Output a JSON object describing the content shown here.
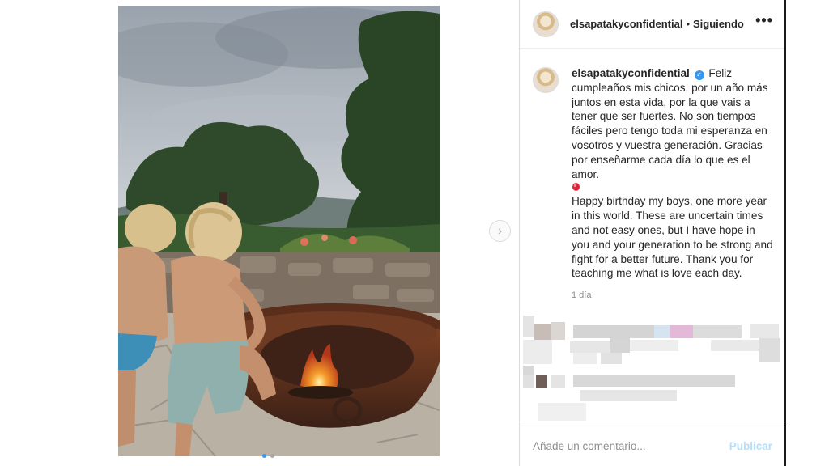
{
  "post": {
    "username": "elsapatakyconfidential",
    "separator": "•",
    "follow_status": "Siguiendo",
    "more_icon": "more-options-icon",
    "caption_spanish": "Feliz cumpleaños mis chicos, por un año más juntos en esta vida, por la que vais a tener que ser fuertes. No son tiempos fáciles pero tengo toda mi esperanza en vosotros y vuestra generación. Gracias por enseñarme cada día lo que es el amor.",
    "caption_english": "Happy birthday my boys, one more year in this world. These are uncertain times and not easy ones, but I have hope in you and your generation to be strong and fight for a better future. Thank you for teaching me what is love each day.",
    "verified_mark": "✓",
    "timestamp": "1 día"
  },
  "comment_bar": {
    "placeholder": "Añade un comentario...",
    "publish_label": "Publicar"
  },
  "carousel": {
    "next_glyph": "›",
    "dots": 2,
    "active_dot": 0
  },
  "colors": {
    "accent": "#3897f0",
    "publish_disabled": "#b2dffc",
    "muted_text": "#8e8e8e",
    "border": "#dbdbdb"
  }
}
